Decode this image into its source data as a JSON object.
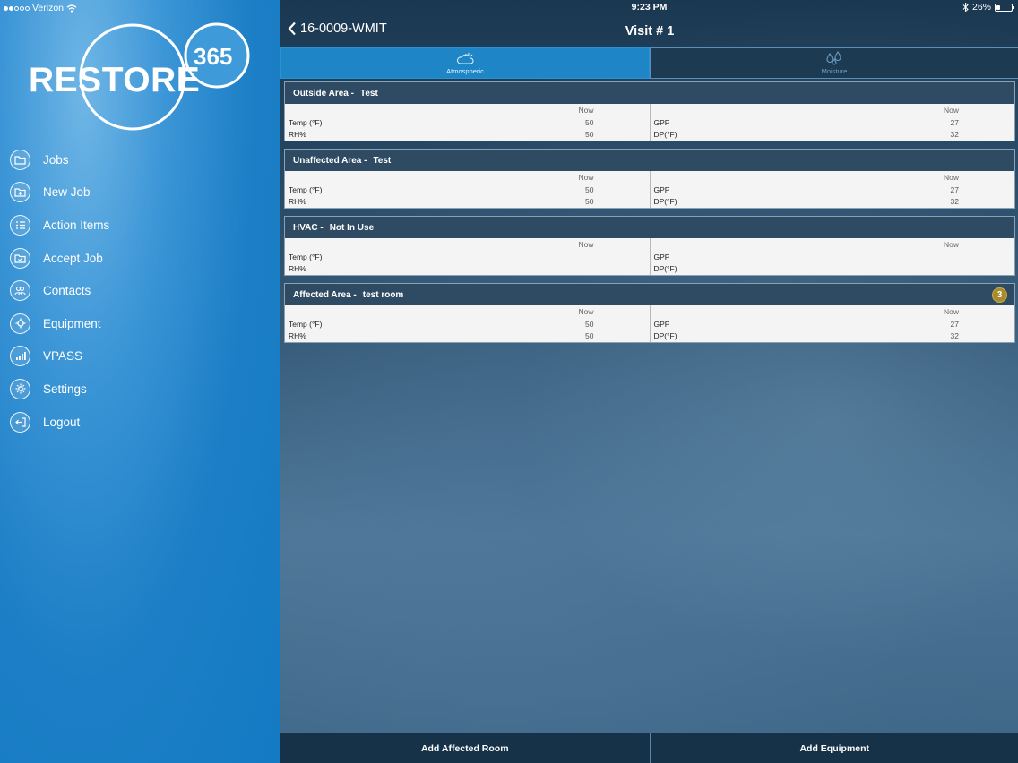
{
  "status_bar": {
    "carrier": "Verizon",
    "time": "9:23 PM",
    "battery": "26%",
    "battery_level": 0.26
  },
  "logo": {
    "wordmark": "RESTORE",
    "number": "365"
  },
  "sidebar": {
    "items": [
      {
        "label": "Jobs",
        "icon": "jobs-folder-icon"
      },
      {
        "label": "New Job",
        "icon": "new-job-icon"
      },
      {
        "label": "Action Items",
        "icon": "checklist-icon"
      },
      {
        "label": "Accept Job",
        "icon": "accept-job-icon"
      },
      {
        "label": "Contacts",
        "icon": "contacts-icon"
      },
      {
        "label": "Equipment",
        "icon": "equipment-icon"
      },
      {
        "label": "VPASS",
        "icon": "signal-bars-icon"
      },
      {
        "label": "Settings",
        "icon": "gear-icon"
      },
      {
        "label": "Logout",
        "icon": "logout-icon"
      }
    ]
  },
  "header": {
    "back_label": "16-0009-WMIT",
    "title": "Visit # 1"
  },
  "tabs": [
    {
      "label": "Atmospheric",
      "icon": "cloud-sun-icon",
      "active": true
    },
    {
      "label": "Moisture",
      "icon": "water-drops-icon",
      "active": false
    }
  ],
  "areas": [
    {
      "type": "Outside Area -",
      "name": "Test",
      "badge": "",
      "now_label": "Now",
      "temp_label": "Temp (°F)",
      "temp": "50",
      "rh_label": "RH%",
      "rh": "50",
      "gpp_label": "GPP",
      "gpp": "27",
      "dp_label": "DP(°F)",
      "dp": "32"
    },
    {
      "type": "Unaffected Area -",
      "name": "Test",
      "badge": "",
      "now_label": "Now",
      "temp_label": "Temp (°F)",
      "temp": "50",
      "rh_label": "RH%",
      "rh": "50",
      "gpp_label": "GPP",
      "gpp": "27",
      "dp_label": "DP(°F)",
      "dp": "32"
    },
    {
      "type": "HVAC -",
      "name": "Not In Use",
      "badge": "",
      "now_label": "Now",
      "temp_label": "Temp (°F)",
      "temp": "",
      "rh_label": "RH%",
      "rh": "",
      "gpp_label": "GPP",
      "gpp": "",
      "dp_label": "DP(°F)",
      "dp": ""
    },
    {
      "type": "Affected Area -",
      "name": "test room",
      "badge": "3",
      "now_label": "Now",
      "temp_label": "Temp (°F)",
      "temp": "50",
      "rh_label": "RH%",
      "rh": "50",
      "gpp_label": "GPP",
      "gpp": "27",
      "dp_label": "DP(°F)",
      "dp": "32"
    }
  ],
  "bottom_bar": {
    "add_room_label": "Add Affected Room",
    "add_equipment_label": "Add Equipment"
  },
  "colors": {
    "sidebar_blue": "#137ac3",
    "active_tab": "#1e86c7",
    "header_navy": "#2e4b63",
    "badge_gold": "#a88b2c"
  }
}
